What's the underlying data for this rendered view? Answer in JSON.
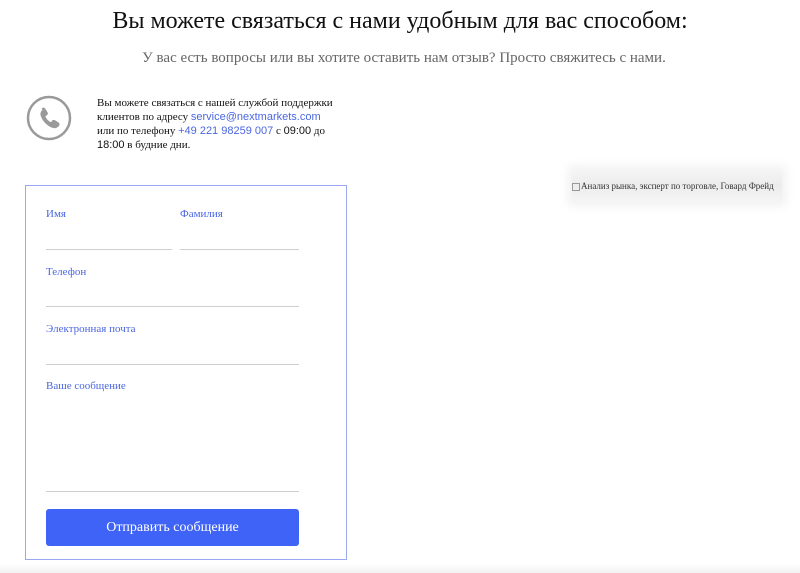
{
  "header": {
    "title": "Вы можете связаться с нами удобным для вас способом:",
    "subtitle": "У вас есть вопросы или вы хотите оставить нам отзыв? Просто свяжитесь с нами."
  },
  "contact": {
    "text_before": "Вы можете связаться с нашей службой поддержки клиентов по адресу ",
    "email": "service@nextmarkets.com",
    "text_middle": " или по телефону ",
    "phone": "+49 221 98259 007",
    "text_c": " с ",
    "time_from": "09:00",
    "text_do": " до ",
    "time_to": "18:00",
    "text_after": " в будние дни.",
    "icon": "phone-icon"
  },
  "form": {
    "first_name_label": "Имя",
    "last_name_label": "Фамилия",
    "phone_label": "Телефон",
    "email_label": "Электронная почта",
    "message_label": "Ваше сообщение",
    "submit_label": "Отправить сообщение",
    "accent_color": "#3f63f6"
  },
  "side_image": {
    "alt_text": "Анализ рынка, эксперт по торговле, Говард Фрейд"
  }
}
